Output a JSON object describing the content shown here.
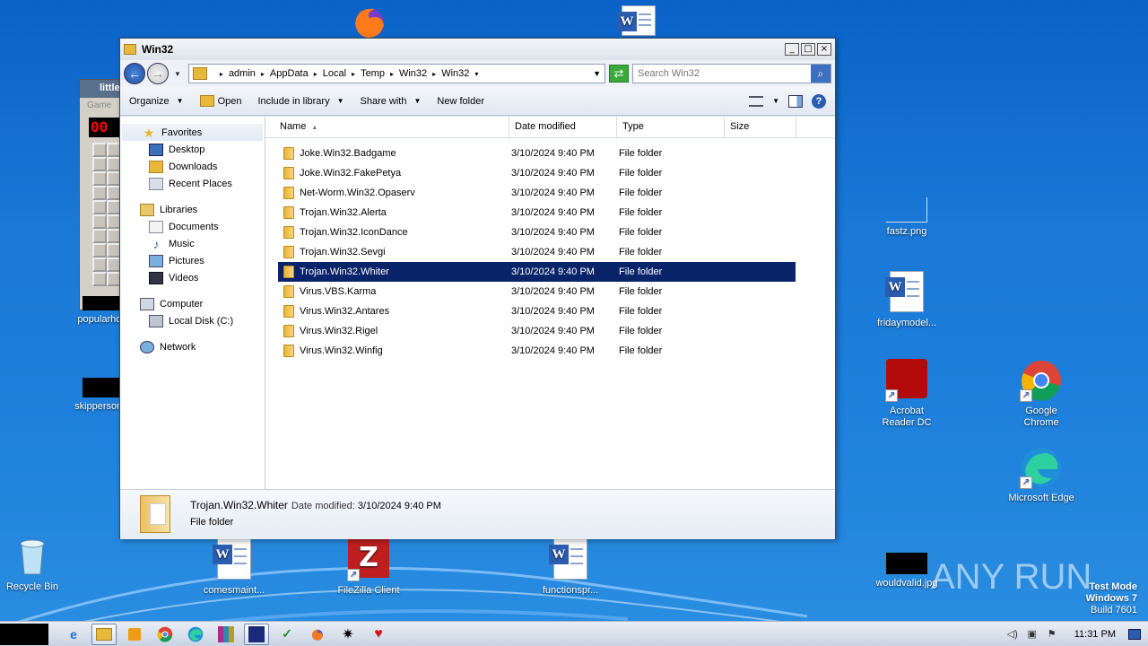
{
  "desktop": {
    "icons": [
      {
        "label": "popularhot..."
      },
      {
        "label": "skippersons..."
      },
      {
        "label": "Recycle Bin"
      },
      {
        "label": "comesmaint..."
      },
      {
        "label": "FileZilla Client"
      },
      {
        "label": "functionspr..."
      },
      {
        "label": "fastz.png"
      },
      {
        "label": "fridaymodel..."
      },
      {
        "label": "Acrobat Reader DC"
      },
      {
        "label": "Google Chrome"
      },
      {
        "label": "Microsoft Edge"
      },
      {
        "label": "wouldvalid.jpg"
      }
    ],
    "minesweeper": {
      "title": "little",
      "menu": "Game",
      "counter": "00"
    },
    "watermark": {
      "line1": "Test Mode",
      "line2": "Windows 7",
      "line3": "Build 7601"
    },
    "anyrun_text": "ANY RUN"
  },
  "window": {
    "title": "Win32",
    "controls": {
      "minimize": "_",
      "maximize": "□",
      "close": "×"
    },
    "breadcrumb": [
      "admin",
      "AppData",
      "Local",
      "Temp",
      "Win32",
      "Win32"
    ],
    "search_placeholder": "Search Win32",
    "toolbar": {
      "organize": "Organize",
      "open": "Open",
      "include_in_library": "Include in library",
      "share_with": "Share with",
      "new_folder": "New folder"
    },
    "nav": {
      "favorites": "Favorites",
      "desktop": "Desktop",
      "downloads": "Downloads",
      "recent_places": "Recent Places",
      "libraries": "Libraries",
      "documents": "Documents",
      "music": "Music",
      "pictures": "Pictures",
      "videos": "Videos",
      "computer": "Computer",
      "local_disk": "Local Disk (C:)",
      "network": "Network"
    },
    "columns": {
      "name": "Name",
      "date": "Date modified",
      "type": "Type",
      "size": "Size"
    },
    "files": [
      {
        "name": "Joke.Win32.Badgame",
        "date": "3/10/2024 9:40 PM",
        "type": "File folder"
      },
      {
        "name": "Joke.Win32.FakePetya",
        "date": "3/10/2024 9:40 PM",
        "type": "File folder"
      },
      {
        "name": "Net-Worm.Win32.Opaserv",
        "date": "3/10/2024 9:40 PM",
        "type": "File folder"
      },
      {
        "name": "Trojan.Win32.Alerta",
        "date": "3/10/2024 9:40 PM",
        "type": "File folder"
      },
      {
        "name": "Trojan.Win32.IconDance",
        "date": "3/10/2024 9:40 PM",
        "type": "File folder"
      },
      {
        "name": "Trojan.Win32.Sevgi",
        "date": "3/10/2024 9:40 PM",
        "type": "File folder"
      },
      {
        "name": "Trojan.Win32.Whiter",
        "date": "3/10/2024 9:40 PM",
        "type": "File folder"
      },
      {
        "name": "Virus.VBS.Karma",
        "date": "3/10/2024 9:40 PM",
        "type": "File folder"
      },
      {
        "name": "Virus.Win32.Antares",
        "date": "3/10/2024 9:40 PM",
        "type": "File folder"
      },
      {
        "name": "Virus.Win32.Rigel",
        "date": "3/10/2024 9:40 PM",
        "type": "File folder"
      },
      {
        "name": "Virus.Win32.Winfig",
        "date": "3/10/2024 9:40 PM",
        "type": "File folder"
      }
    ],
    "details": {
      "name": "Trojan.Win32.Whiter",
      "date_label": "Date modified:",
      "date_value": "3/10/2024 9:40 PM",
      "type": "File folder"
    }
  },
  "taskbar": {
    "clock": "11:31 PM"
  },
  "colors": {
    "selection": "#0a246a",
    "desktop": "#1a78d6"
  }
}
